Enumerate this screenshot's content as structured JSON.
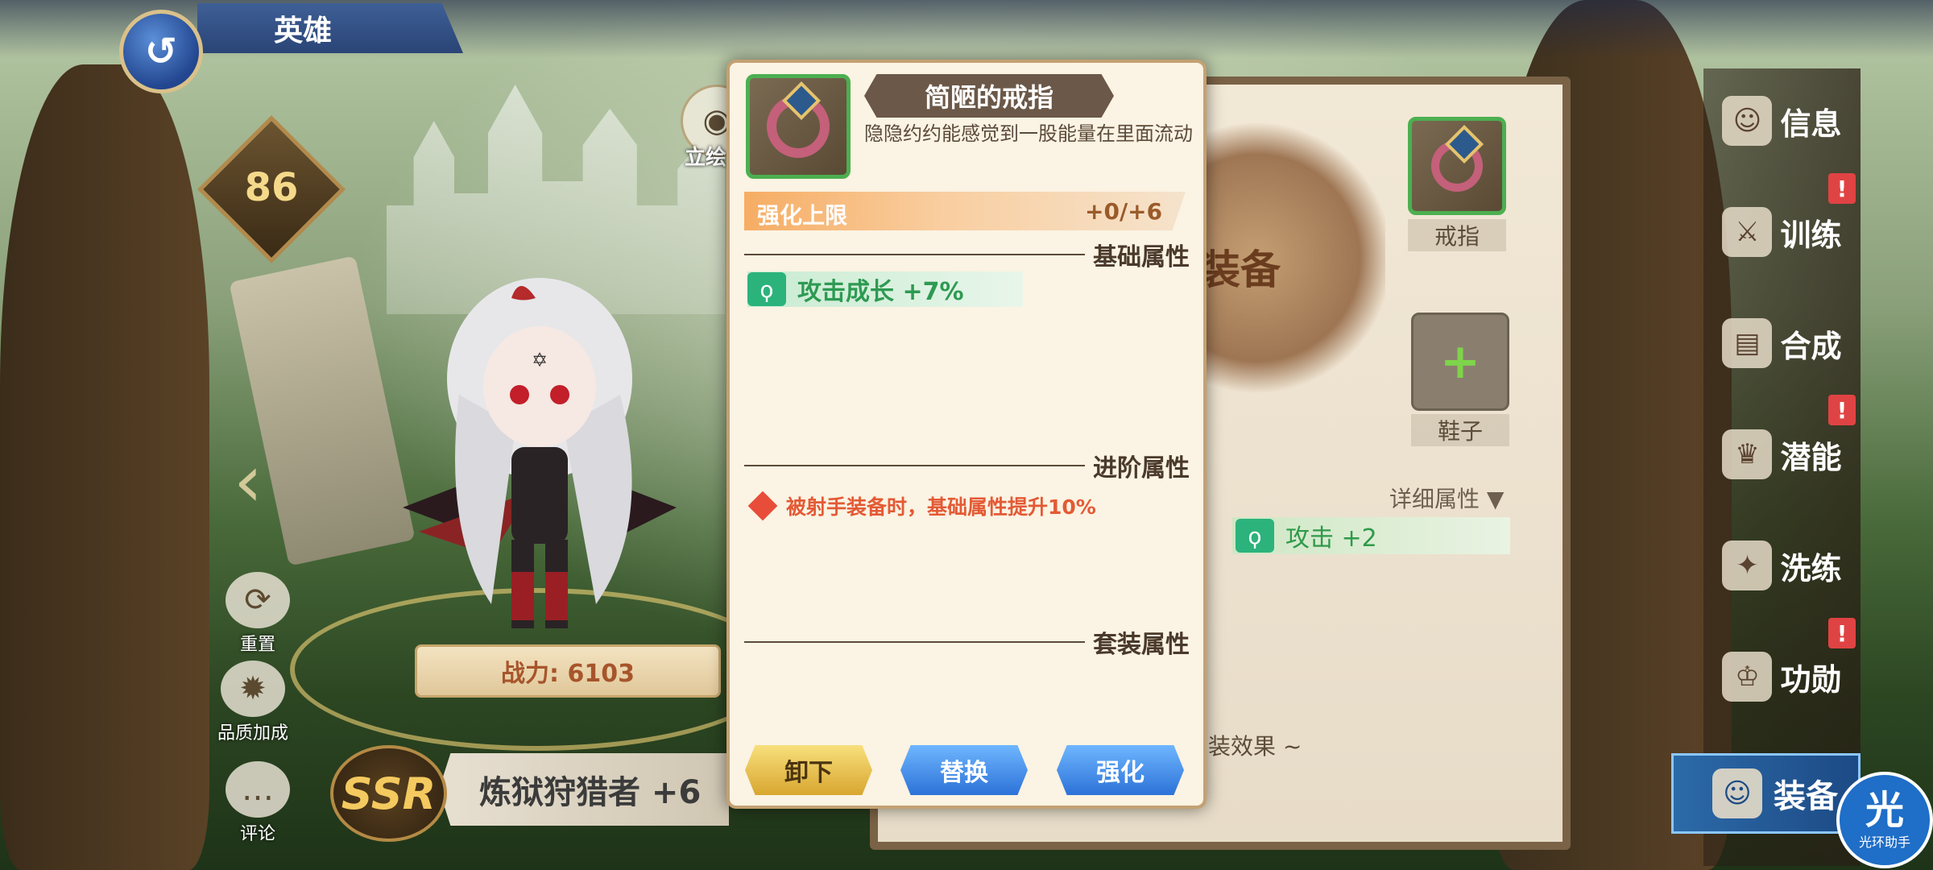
{
  "header": {
    "title": "英雄",
    "back_icon": "back-swirl-icon"
  },
  "hero": {
    "level": "86",
    "power": "战力: 6103",
    "rarity": "SSR",
    "name": "炼狱狩猎者 +6",
    "view_label": "立绘"
  },
  "left_actions": [
    {
      "label": "重置",
      "icon": "reset-icon"
    },
    {
      "label": "品质加成",
      "icon": "quality-flame-icon"
    },
    {
      "label": "评论",
      "icon": "comment-bubble-icon"
    }
  ],
  "tooltip": {
    "item_name": "简陋的戒指",
    "description": "隐隐约约能感觉到一股能量在里面流动",
    "enhance_label": "强化上限",
    "enhance_value": "+0/+6",
    "base_header": "基础属性",
    "base_attr": "攻击成长 +7%",
    "advanced_header": "进阶属性",
    "advanced_attr": "被射手装备时，基础属性提升10%",
    "set_header": "套装属性",
    "buttons": {
      "unequip": "卸下",
      "replace": "替换",
      "enhance": "强化"
    }
  },
  "equip_panel": {
    "emblem_text": "装备",
    "ring_label": "戒指",
    "shoes_label": "鞋子",
    "detail_label": "详细属性",
    "attack_attr": "攻击 +2",
    "set_effect_text": "装效果 ~"
  },
  "right_menu": [
    {
      "label": "信息",
      "icon": "info-face-icon",
      "alert": false
    },
    {
      "label": "训练",
      "icon": "training-icon",
      "alert": true
    },
    {
      "label": "合成",
      "icon": "compose-cards-icon",
      "alert": false
    },
    {
      "label": "潜能",
      "icon": "potential-crown-icon",
      "alert": true
    },
    {
      "label": "洗练",
      "icon": "refine-icon",
      "alert": false
    },
    {
      "label": "功勋",
      "icon": "merit-crown-icon",
      "alert": true
    }
  ],
  "active_tab": {
    "label": "装备",
    "icon": "equip-face-icon"
  },
  "helper_logo": {
    "big": "光",
    "small": "光环助手"
  },
  "colors": {
    "accent_green": "#2e9a52",
    "advanced_red": "#e35a35",
    "button_blue": "#2c72d8",
    "button_gold": "#d8a630"
  }
}
